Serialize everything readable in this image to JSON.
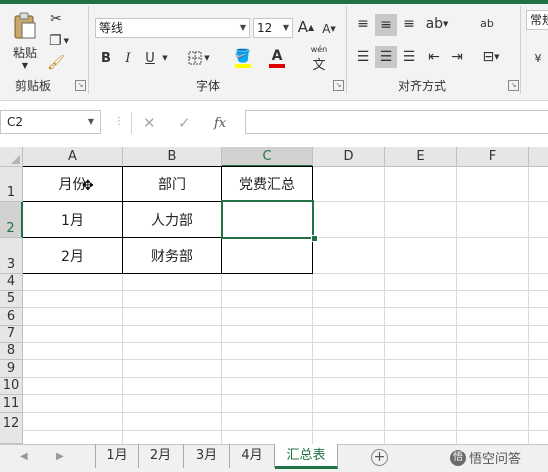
{
  "ribbon": {
    "clipboard": {
      "paste_label": "粘贴",
      "group_label": "剪贴板"
    },
    "font": {
      "name": "等线",
      "size": "12",
      "bold": "B",
      "italic": "I",
      "underline": "U",
      "group_label": "字体",
      "phonetic": "wén"
    },
    "alignment": {
      "group_label": "对齐方式"
    },
    "number": {
      "format": "常规",
      "wrap_label": "ab"
    }
  },
  "formula_bar": {
    "name_box": "C2",
    "formula": ""
  },
  "grid": {
    "columns": [
      "A",
      "B",
      "C",
      "D",
      "E",
      "F"
    ],
    "rows": [
      "1",
      "2",
      "3",
      "4",
      "5",
      "6",
      "7",
      "8",
      "9",
      "10",
      "11",
      "12"
    ],
    "cells": {
      "A1": "月份",
      "B1": "部门",
      "C1": "党费汇总",
      "A2": "1月",
      "B2": "人力部",
      "C2": "",
      "A3": "2月",
      "B3": "财务部",
      "C3": ""
    },
    "selected_cell": "C2"
  },
  "sheet_tabs": [
    "1月",
    "2月",
    "3月",
    "4月",
    "汇总表"
  ],
  "active_sheet": "汇总表",
  "watermark": "悟空问答",
  "colors": {
    "accent": "#217346",
    "ribbon_bg": "#f3f3f3",
    "header_bg": "#e6e6e6"
  }
}
